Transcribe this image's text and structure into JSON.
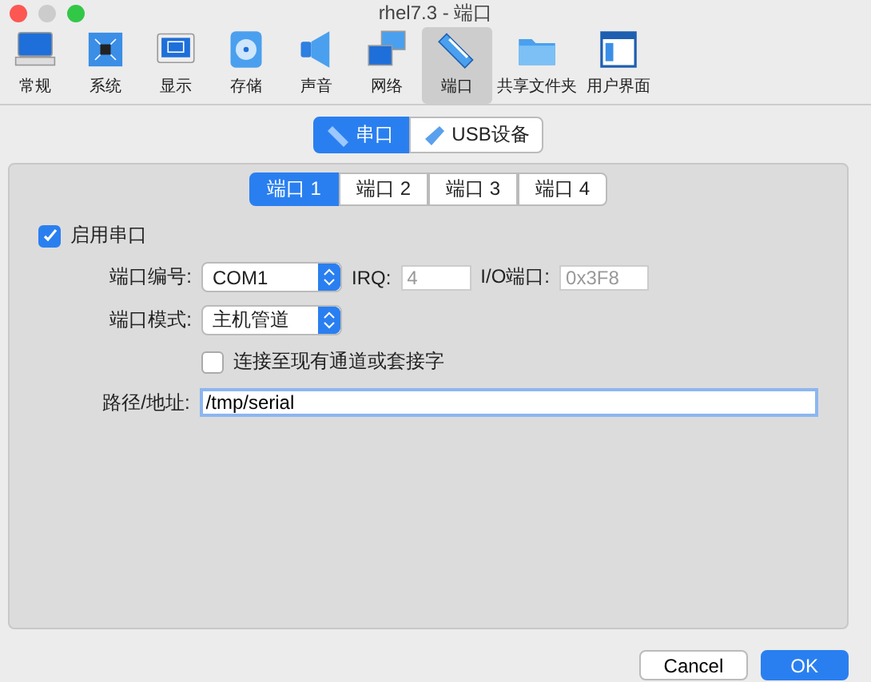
{
  "window": {
    "title": "rhel7.3 - 端口"
  },
  "toolbar": [
    {
      "label": "常规",
      "kind": "general",
      "selected": false
    },
    {
      "label": "系统",
      "kind": "system",
      "selected": false
    },
    {
      "label": "显示",
      "kind": "display",
      "selected": false
    },
    {
      "label": "存储",
      "kind": "storage",
      "selected": false
    },
    {
      "label": "声音",
      "kind": "audio",
      "selected": false
    },
    {
      "label": "网络",
      "kind": "network",
      "selected": false
    },
    {
      "label": "端口",
      "kind": "ports",
      "selected": true
    },
    {
      "label": "共享文件夹",
      "kind": "folder",
      "selected": false
    },
    {
      "label": "用户界面",
      "kind": "ui",
      "selected": false
    }
  ],
  "segments": [
    {
      "label": "串口",
      "kind": "serial",
      "selected": true
    },
    {
      "label": "USB设备",
      "kind": "usb",
      "selected": false
    }
  ],
  "port_tabs": [
    {
      "label": "端口 1",
      "selected": true
    },
    {
      "label": "端口 2",
      "selected": false
    },
    {
      "label": "端口 3",
      "selected": false
    },
    {
      "label": "端口 4",
      "selected": false
    }
  ],
  "enable": {
    "label": "启用串口",
    "checked": true
  },
  "port_number": {
    "label": "端口编号:",
    "value": "COM1"
  },
  "irq": {
    "label": "IRQ:",
    "value": "4"
  },
  "io_port": {
    "label": "I/O端口:",
    "value": "0x3F8"
  },
  "port_mode": {
    "label": "端口模式:",
    "value": "主机管道"
  },
  "connect_existing": {
    "label": "连接至现有通道或套接字",
    "checked": false
  },
  "path": {
    "label": "路径/地址:",
    "value": "/tmp/serial"
  },
  "buttons": [
    {
      "label": "Cancel",
      "kind": "default"
    },
    {
      "label": "OK",
      "kind": "primary"
    }
  ]
}
